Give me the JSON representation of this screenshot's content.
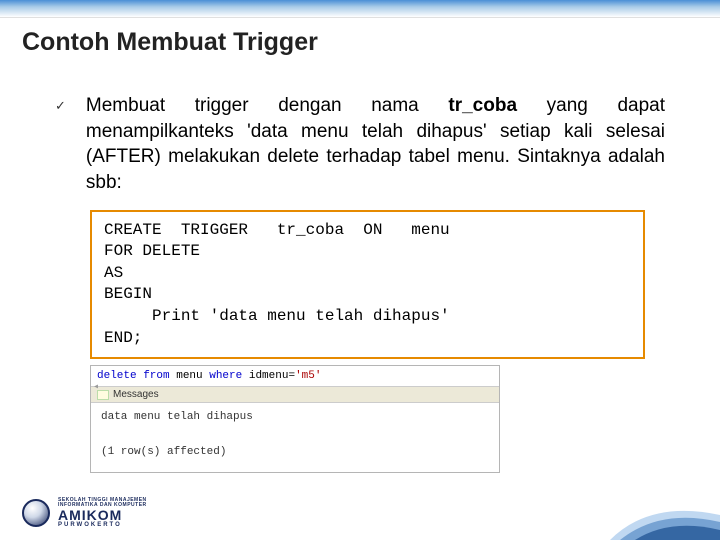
{
  "title": "Contoh Membuat Trigger",
  "bullet_mark": "✓",
  "body": {
    "pre": "Membuat trigger dengan nama ",
    "trigname": "tr_coba",
    "post": " yang dapat menampilkanteks 'data menu telah dihapus' setiap kali selesai (AFTER) melakukan delete terhadap tabel menu. Sintaknya adalah sbb:"
  },
  "code": "CREATE  TRIGGER   tr_coba  ON   menu\nFOR DELETE\nAS\nBEGIN\n     Print 'data menu telah dihapus'\nEND;",
  "sql": {
    "kw1": "delete from",
    "tbl": " menu ",
    "kw2": "where",
    "col": " idmenu",
    "eq": "=",
    "val": "'m5'"
  },
  "messages_tab": "Messages",
  "msg_line1": "data menu telah dihapus",
  "msg_line2": "(1 row(s) affected)",
  "footer": {
    "line1": "SEKOLAH TINGGI MANAJEMEN",
    "line2": "INFORMATIKA DAN KOMPUTER",
    "main": "AMIKOM",
    "sub": "PURWOKERTO"
  }
}
